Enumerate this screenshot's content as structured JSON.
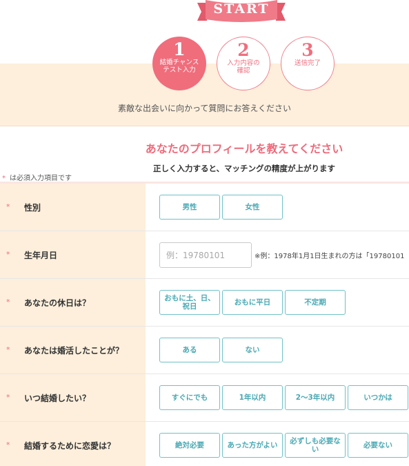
{
  "header": {
    "start_label": "START",
    "steps": [
      {
        "number": "1",
        "label": "結婚チャンス\nテスト入力",
        "active": true
      },
      {
        "number": "2",
        "label": "入力内容の\n確認",
        "active": false
      },
      {
        "number": "3",
        "label": "送信完了",
        "active": false
      }
    ],
    "intro": "素敵な出会いに向かって質問にお答えください"
  },
  "section": {
    "title": "あなたのプロフィールを教えてください",
    "subtitle": "正しく入力すると、マッチングの精度が上がります",
    "required_mark": "*",
    "required_note": "は必須入力項目です"
  },
  "form": {
    "gender": {
      "label": "性別",
      "options": [
        "男性",
        "女性"
      ]
    },
    "birthdate": {
      "label": "生年月日",
      "placeholder": "例：19780101",
      "value": "",
      "hint": "※例：1978年1月1日生まれの方は「19780101"
    },
    "holiday": {
      "label": "あなたの休日は？",
      "options": [
        "おもに土、日、祝日",
        "おもに平日",
        "不定期"
      ]
    },
    "konkatsu": {
      "label": "あなたは婚活したことが？",
      "options": [
        "ある",
        "ない"
      ]
    },
    "when_marry": {
      "label": "いつ結婚したい？",
      "options": [
        "すぐにでも",
        "1年以内",
        "2〜3年以内",
        "いつかは"
      ]
    },
    "romance": {
      "label": "結婚するために恋愛は？",
      "options": [
        "絶対必要",
        "あった方がよい",
        "必ずしも必要ない",
        "必要ない"
      ]
    }
  },
  "colors": {
    "accent_pink": "#f06d7c",
    "band_beige": "#fdefdc",
    "option_teal": "#4aa9b4"
  }
}
